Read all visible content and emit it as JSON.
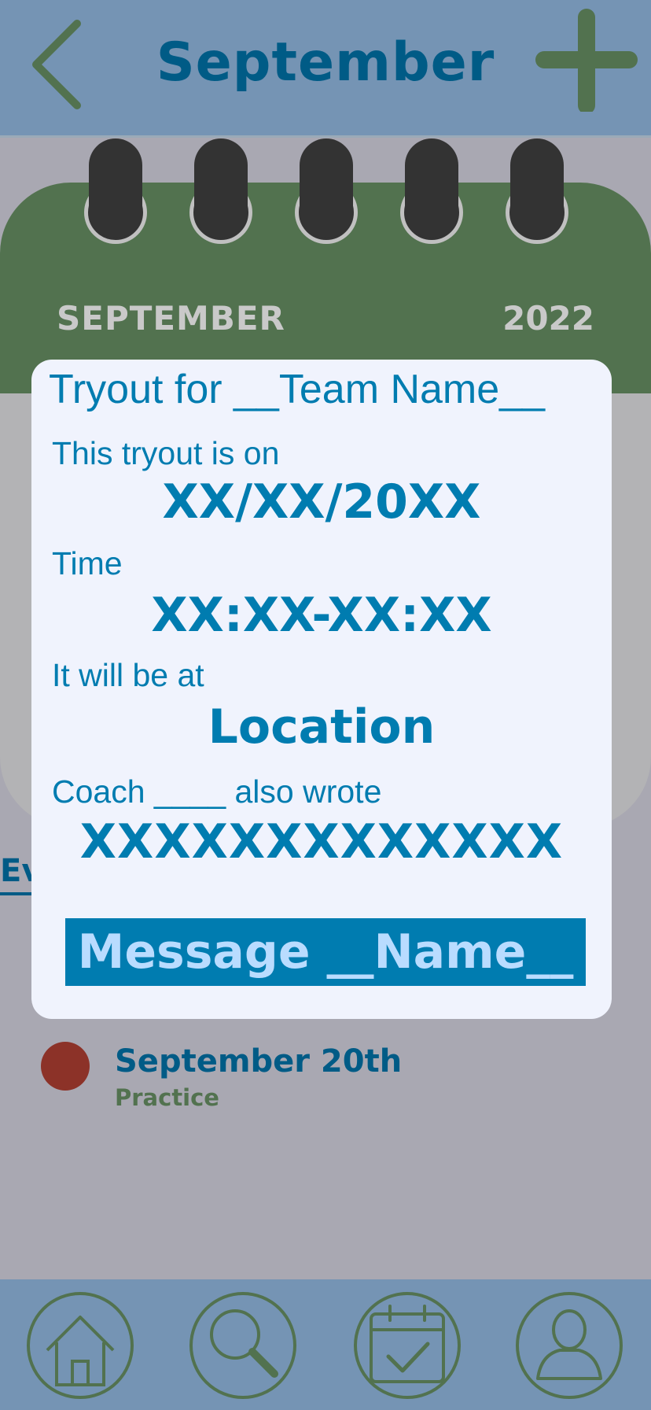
{
  "header": {
    "title": "September",
    "back_icon": "chevron-left-icon",
    "add_icon": "plus-icon"
  },
  "calendar": {
    "month": "SEPTEMBER",
    "year": "2022"
  },
  "events_section": {
    "heading_partial": "Ev"
  },
  "modal": {
    "title": "Tryout for __Team Name__",
    "date_label": "This tryout is on",
    "date_value": "XX/XX/20XX",
    "time_label": "Time",
    "time_value": "XX:XX-XX:XX",
    "location_label": "It will be at",
    "location_value": "Location",
    "note_label": "Coach ____ also wrote",
    "note_value": "XXXXXXXXXXXXX",
    "message_button": "Message __Name__"
  },
  "events": [
    {
      "date": "September 20th",
      "type": "Practice",
      "dot_color": "#8c3228"
    }
  ],
  "bottom_nav": {
    "items": [
      {
        "icon": "home-icon"
      },
      {
        "icon": "search-icon"
      },
      {
        "icon": "calendar-check-icon"
      },
      {
        "icon": "profile-icon"
      }
    ]
  },
  "colors": {
    "header_bg": "#7594b4",
    "title_blue": "#005b86",
    "accent_blue": "#007cb0",
    "green": "#52724f",
    "backdrop": "#a9a8b2",
    "modal_bg": "#f0f3fd"
  }
}
